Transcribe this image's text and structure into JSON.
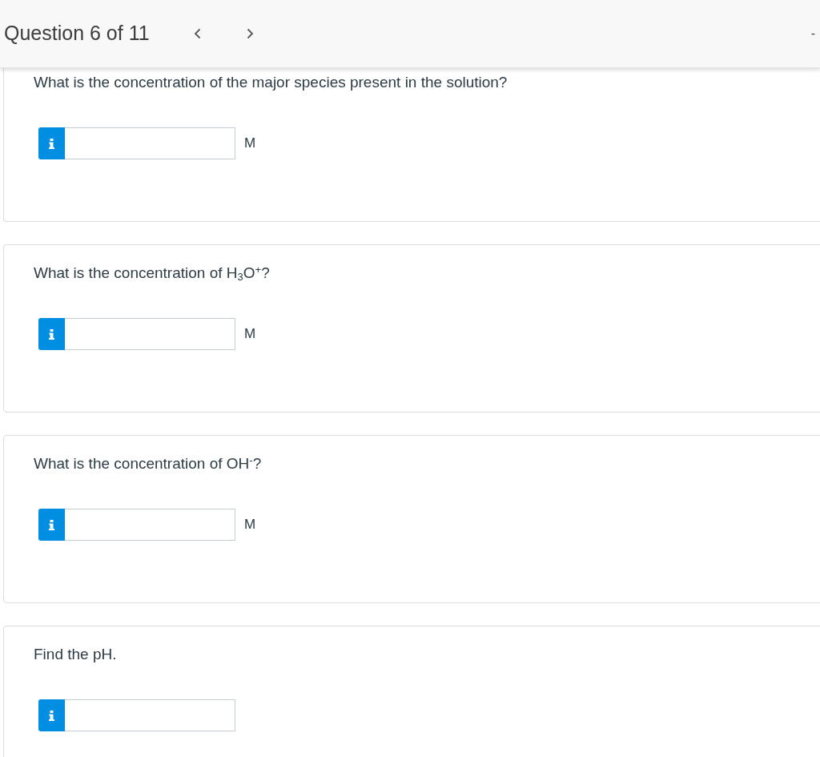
{
  "header": {
    "title": "Question 6 of 11",
    "edge_text": "-"
  },
  "questions": [
    {
      "prompt": "What is the concentration of the major species present in the solution?",
      "unit": "M"
    },
    {
      "prompt": "What is the concentration of H$_{3}$O$^{+}$?",
      "unit": "M"
    },
    {
      "prompt": "What is the concentration of OH$^{-}$?",
      "unit": "M"
    },
    {
      "prompt": "Find the pH."
    }
  ]
}
